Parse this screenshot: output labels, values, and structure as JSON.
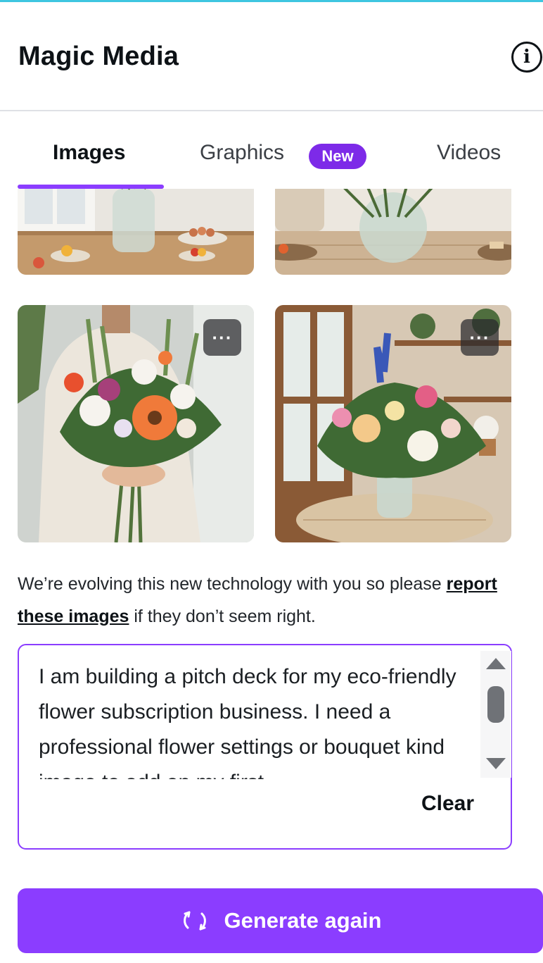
{
  "header": {
    "title": "Magic Media",
    "info_icon": "info-icon"
  },
  "tabs": [
    {
      "label": "Images",
      "active": true
    },
    {
      "label": "Graphics",
      "badge": "New"
    },
    {
      "label": "Videos"
    }
  ],
  "gallery": {
    "more_label": "···",
    "images": [
      {
        "icon": "table-vase-image"
      },
      {
        "icon": "vase-table-image"
      },
      {
        "icon": "woman-bouquet-image"
      },
      {
        "icon": "vase-window-image"
      }
    ]
  },
  "disclaimer": {
    "before": "We’re evolving this new technology with you so please ",
    "link": "report these images",
    "after": " if they don’t seem right."
  },
  "prompt": {
    "value": "I am building a pitch deck for my eco-friendly flower subscription business. I need a professional flower settings or bouquet kind image to add on my first",
    "clear_label": "Clear"
  },
  "generate": {
    "label": "Generate again",
    "icon": "refresh-icon"
  },
  "colors": {
    "accent": "#8b3dff",
    "badge": "#7d2ae8",
    "top_bar": "#3ec6e0"
  }
}
